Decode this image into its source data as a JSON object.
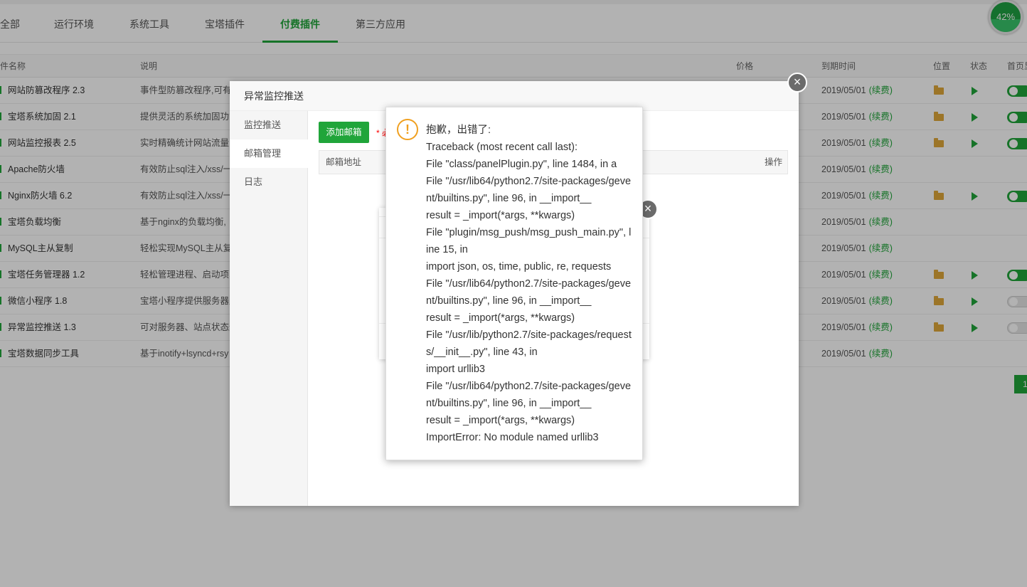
{
  "tabs": [
    {
      "label": "全部",
      "active": false
    },
    {
      "label": "运行环境",
      "active": false
    },
    {
      "label": "系统工具",
      "active": false
    },
    {
      "label": "宝塔插件",
      "active": false
    },
    {
      "label": "付费插件",
      "active": true
    },
    {
      "label": "第三方应用",
      "active": false
    }
  ],
  "progress": {
    "label": "42%",
    "value": 0.42
  },
  "table": {
    "headers": {
      "name": "件名称",
      "desc": "说明",
      "price": "价格",
      "expire": "到期时间",
      "location": "位置",
      "status": "状态",
      "home": "首页显"
    },
    "rows": [
      {
        "name": "网站防篡改程序 2.3",
        "desc": "事件型防篡改程序,可有效",
        "expire": "2019/05/01",
        "renew": "(续费)",
        "folder": true,
        "play": true,
        "toggle": "on"
      },
      {
        "name": "宝塔系统加固 2.1",
        "desc": "提供灵活的系统加固功能",
        "expire": "2019/05/01",
        "renew": "(续费)",
        "folder": true,
        "play": true,
        "toggle": "on"
      },
      {
        "name": "网站监控报表 2.5",
        "desc": "实时精确统计网站流量",
        "expire": "2019/05/01",
        "renew": "(续费)",
        "folder": true,
        "play": true,
        "toggle": "on"
      },
      {
        "name": "Apache防火墙",
        "desc": "有效防止sql注入/xss/一",
        "expire": "2019/05/01",
        "renew": "(续费)",
        "folder": false,
        "play": false,
        "toggle": "none"
      },
      {
        "name": "Nginx防火墙 6.2",
        "desc": "有效防止sql注入/xss/一",
        "expire": "2019/05/01",
        "renew": "(续费)",
        "folder": true,
        "play": true,
        "toggle": "on"
      },
      {
        "name": "宝塔负载均衡",
        "desc": "基于nginx的负载均衡,",
        "expire": "2019/05/01",
        "renew": "(续费)",
        "folder": false,
        "play": false,
        "toggle": "none"
      },
      {
        "name": "MySQL主从复制",
        "desc": "轻松实现MySQL主从复",
        "expire": "2019/05/01",
        "renew": "(续费)",
        "folder": false,
        "play": false,
        "toggle": "none"
      },
      {
        "name": "宝塔任务管理器 1.2",
        "desc": "轻松管理进程、启动项、",
        "expire": "2019/05/01",
        "renew": "(续费)",
        "folder": true,
        "play": true,
        "toggle": "on"
      },
      {
        "name": "微信小程序 1.8",
        "desc": "宝塔小程序提供服务器监",
        "expire": "2019/05/01",
        "renew": "(续费)",
        "folder": true,
        "play": true,
        "toggle": "off"
      },
      {
        "name": "异常监控推送 1.3",
        "desc": "可对服务器、站点状态进",
        "expire": "2019/05/01",
        "renew": "(续费)",
        "folder": true,
        "play": true,
        "toggle": "off"
      },
      {
        "name": "宝塔数据同步工具",
        "desc": "基于inotify+lsyncd+rsy",
        "expire": "2019/05/01",
        "renew": "(续费)",
        "folder": false,
        "play": false,
        "toggle": "none"
      }
    ]
  },
  "pager": {
    "current": "1"
  },
  "dialog": {
    "title": "异常监控推送",
    "side_items": [
      {
        "label": "监控推送",
        "active": false
      },
      {
        "label": "邮箱管理",
        "active": true
      },
      {
        "label": "日志",
        "active": false
      }
    ],
    "add_button": "添加邮箱",
    "required_note": "* 必",
    "mail_table": {
      "col_address": "邮箱地址",
      "col_action": "操作"
    },
    "close_symbol": "×"
  },
  "subdialog": {
    "close_symbol": "×"
  },
  "error": {
    "icon_symbol": "!",
    "lines": [
      "抱歉，出错了:",
      "Traceback (most recent call last):",
      "File \"class/panelPlugin.py\", line 1484, in a",
      "File \"/usr/lib64/python2.7/site-packages/gevent/builtins.py\", line 96, in __import__",
      "result = _import(*args, **kwargs)",
      "File \"plugin/msg_push/msg_push_main.py\", line 15, in",
      "import json, os, time, public, re, requests",
      "File \"/usr/lib64/python2.7/site-packages/gevent/builtins.py\", line 96, in __import__",
      "result = _import(*args, **kwargs)",
      "File \"/usr/lib/python2.7/site-packages/requests/__init__.py\", line 43, in",
      "import urllib3",
      "File \"/usr/lib64/python2.7/site-packages/gevent/builtins.py\", line 96, in __import__",
      "result = _import(*args, **kwargs)",
      "ImportError: No module named urllib3"
    ]
  },
  "colors": {
    "accent": "#20a53a",
    "warning": "#f0a020"
  }
}
